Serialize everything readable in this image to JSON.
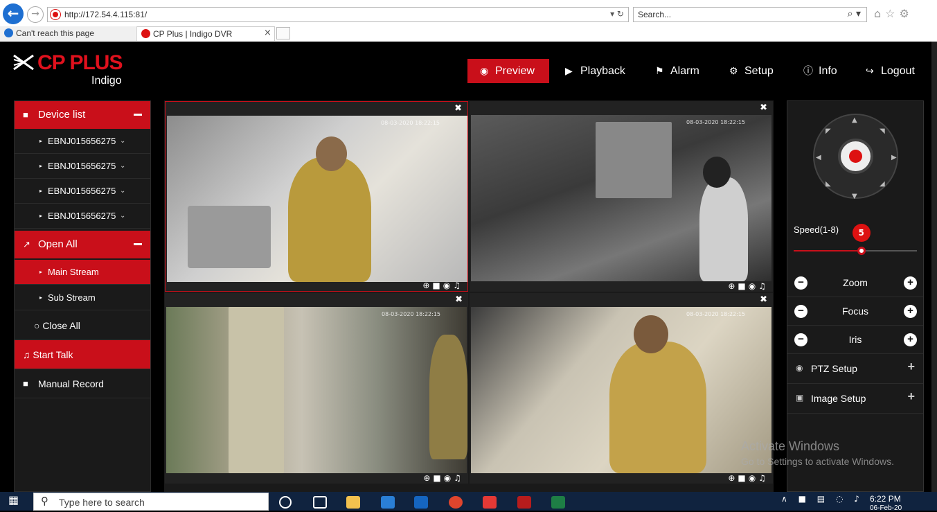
{
  "browser": {
    "back_label": "←",
    "forward_label": "→",
    "address": "http://172.54.4.115:81/",
    "address_tools": "▾ ↻",
    "search_placeholder": "Search...",
    "search_icon": "⌕ ▾",
    "toolbar_icons": "⌂☆⚙",
    "tabs": [
      {
        "label": "Can't reach this page"
      },
      {
        "label": "CP Plus | Indigo DVR"
      }
    ],
    "tab_close": "×"
  },
  "app": {
    "logo": "CP PLUS",
    "logo_sub": "Indigo",
    "accent_color": "#c90f1a",
    "nav": [
      {
        "label": "Preview",
        "icon": "eye-icon",
        "glyph": "◉",
        "active": true
      },
      {
        "label": "Playback",
        "icon": "play-icon",
        "glyph": "▶"
      },
      {
        "label": "Alarm",
        "icon": "bell-icon",
        "glyph": "⚑"
      },
      {
        "label": "Setup",
        "icon": "gear-icon",
        "glyph": "⚙"
      },
      {
        "label": "Info",
        "icon": "info-icon",
        "glyph": "ⓘ"
      },
      {
        "label": "Logout",
        "icon": "logout-icon",
        "glyph": "↪"
      }
    ]
  },
  "sidebar": {
    "device_list": "Device list",
    "devices": [
      "EBNJ015656275",
      "EBNJ015656275",
      "EBNJ015656275",
      "EBNJ015656275"
    ],
    "open_all": "Open All",
    "main_stream": "Main Stream",
    "sub_stream": "Sub Stream",
    "close_all": "Close All",
    "start_talk": "Start Talk",
    "manual_record": "Manual Record",
    "bullet": "▸",
    "chevron": "⌄"
  },
  "video": {
    "close": "✖",
    "tools": "⊕■◉♫",
    "timestamps": [
      "08-03-2020 18:22:15",
      "08-03-2020 18:22:15",
      "08-03-2020 18:22:15",
      "08-03-2020 18:22:15"
    ]
  },
  "ptz": {
    "speed_label": "Speed(1-8)",
    "speed_value": "5",
    "speed_min": 1,
    "speed_max": 8,
    "zoom": "Zoom",
    "focus": "Focus",
    "iris": "Iris",
    "minus": "−",
    "plus": "+",
    "ptz_setup": "PTZ Setup",
    "image_setup": "Image Setup"
  },
  "watermark": {
    "line1": "Activate Windows",
    "line2": "Go to Settings to activate Windows."
  },
  "taskbar": {
    "search_placeholder": "Type here to search",
    "time": "6:22 PM",
    "date": "06-Feb-20",
    "tray_icons": "∧ ■ ▤ ◌ ♪"
  }
}
